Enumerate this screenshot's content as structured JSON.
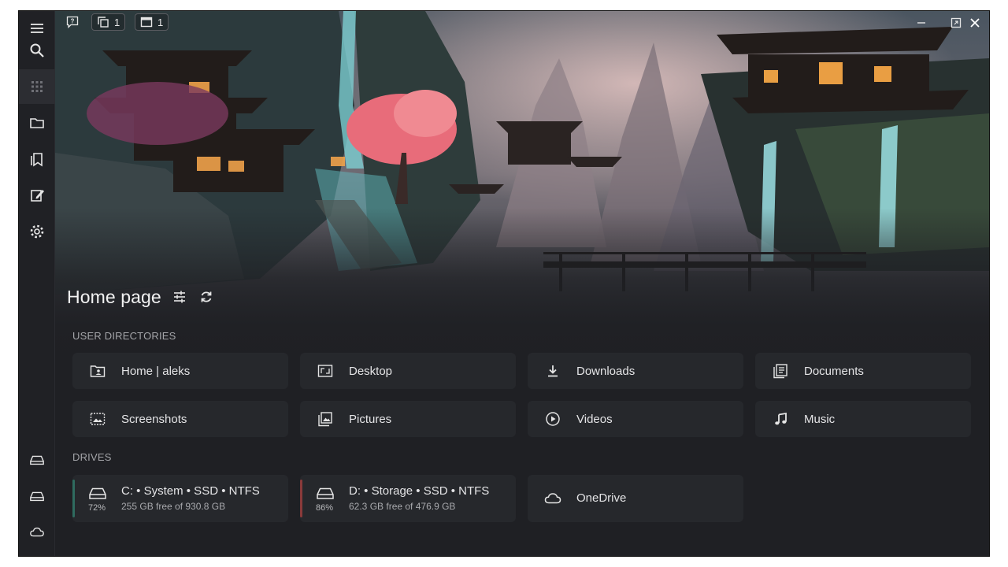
{
  "topbar": {
    "panes_count": "1",
    "tabs_count": "1"
  },
  "page": {
    "title": "Home page"
  },
  "sections": {
    "user_dirs_label": "USER DIRECTORIES",
    "drives_label": "DRIVES"
  },
  "user_dirs": [
    {
      "label": "Home | aleks",
      "icon": "home-folder-icon"
    },
    {
      "label": "Desktop",
      "icon": "desktop-icon"
    },
    {
      "label": "Downloads",
      "icon": "download-icon"
    },
    {
      "label": "Documents",
      "icon": "documents-icon"
    },
    {
      "label": "Screenshots",
      "icon": "screenshot-icon"
    },
    {
      "label": "Pictures",
      "icon": "pictures-icon"
    },
    {
      "label": "Videos",
      "icon": "video-icon"
    },
    {
      "label": "Music",
      "icon": "music-icon"
    }
  ],
  "drives": [
    {
      "name": "C: • System • SSD • NTFS",
      "free": "255 GB free of 930.8 GB",
      "used_pct": "72%",
      "bar_color": "#2f6b5f"
    },
    {
      "name": "D: • Storage • SSD • NTFS",
      "free": "62.3 GB free of 476.9 GB",
      "used_pct": "86%",
      "bar_color": "#8a3a3a"
    },
    {
      "name": "OneDrive"
    }
  ],
  "colors": {
    "background": "#1f2024",
    "card": "#2c2d32",
    "text": "#e4e4e6",
    "muted": "#a3a4a8"
  }
}
